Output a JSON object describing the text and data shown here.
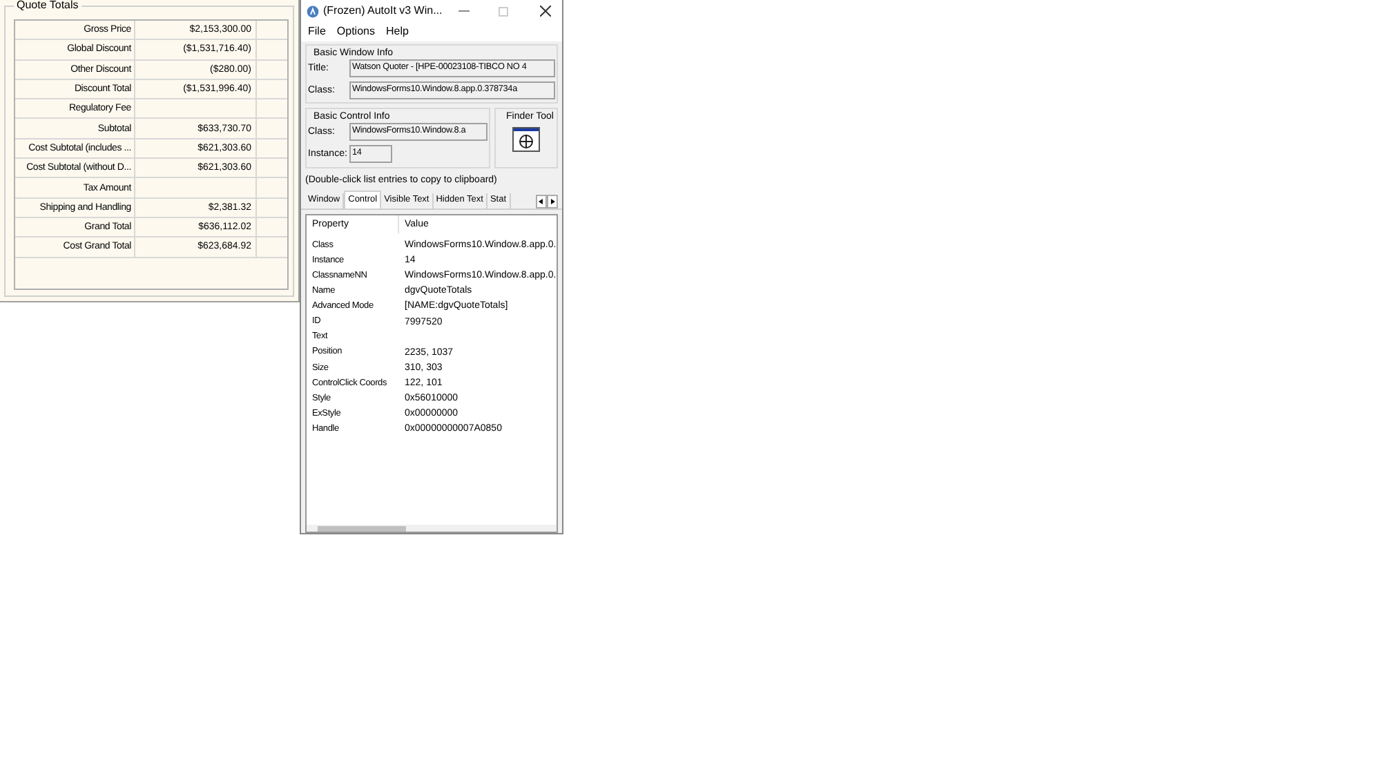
{
  "quote_totals": {
    "title": "Quote Totals",
    "rows": [
      {
        "label": "Gross Price",
        "value": "$2,153,300.00"
      },
      {
        "label": "Global Discount",
        "value": "($1,531,716.40)"
      },
      {
        "label": "Other Discount",
        "value": "($280.00)"
      },
      {
        "label": "Discount Total",
        "value": "($1,531,996.40)"
      },
      {
        "label": "Regulatory Fee"
      },
      {
        "label": "Subtotal",
        "value": "$633,730.70"
      },
      {
        "label": "Cost Subtotal (includes ...",
        "value": "$621,303.60"
      },
      {
        "label": "Cost Subtotal (without D...",
        "value": "$621,303.60"
      },
      {
        "label": "Tax Amount"
      },
      {
        "label": "Shipping and Handling",
        "value": "$2,381.32"
      },
      {
        "label": "Grand Total",
        "value": "$636,112.02"
      },
      {
        "label": "Cost Grand Total",
        "value": "$623,684.92"
      }
    ]
  },
  "window": {
    "title": "(Frozen) AutoIt v3 Win...",
    "menu": [
      "File",
      "Options",
      "Help"
    ],
    "window_info": {
      "title": "Basic Window Info",
      "fields": [
        {
          "label": "Title:",
          "value": "Watson Quoter - [HPE-00023108-TIBCO NO 4"
        },
        {
          "label": "Class:",
          "value": "WindowsForms10.Window.8.app.0.378734a"
        }
      ]
    },
    "control_info": {
      "title": "Basic Control Info",
      "fields": [
        {
          "label": "Class:",
          "value": "WindowsForms10.Window.8.a"
        },
        {
          "label": "Instance:",
          "value": "14"
        }
      ]
    },
    "finder_tool": {
      "title": "Finder Tool"
    },
    "hint": "(Double-click list entries to copy to clipboard)",
    "tabs": [
      {
        "label": "Window",
        "selected": false
      },
      {
        "label": "Control",
        "selected": true
      },
      {
        "label": "Visible Text",
        "selected": false
      },
      {
        "label": "Hidden Text",
        "selected": false
      },
      {
        "label": "Stat",
        "selected": false
      }
    ],
    "list": {
      "columns": [
        "Property",
        "Value"
      ],
      "rows": [
        [
          "Class",
          "WindowsForms10.Window.8.app.0."
        ],
        [
          "Instance",
          "14"
        ],
        [
          "ClassnameNN",
          "WindowsForms10.Window.8.app.0."
        ],
        [
          "Name",
          "dgvQuoteTotals"
        ],
        [
          "Advanced Mode",
          "[NAME:dgvQuoteTotals]"
        ],
        [
          "ID",
          "7997520"
        ],
        [
          "Text"
        ],
        [
          "Position",
          "2235, 1037"
        ],
        [
          "Size",
          "310, 303"
        ],
        [
          "ControlClick Coords",
          "122, 101"
        ],
        [
          "Style",
          "0x56010000"
        ],
        [
          "ExStyle",
          "0x00000000"
        ],
        [
          "Handle",
          "0x00000000007A0850"
        ]
      ]
    }
  }
}
